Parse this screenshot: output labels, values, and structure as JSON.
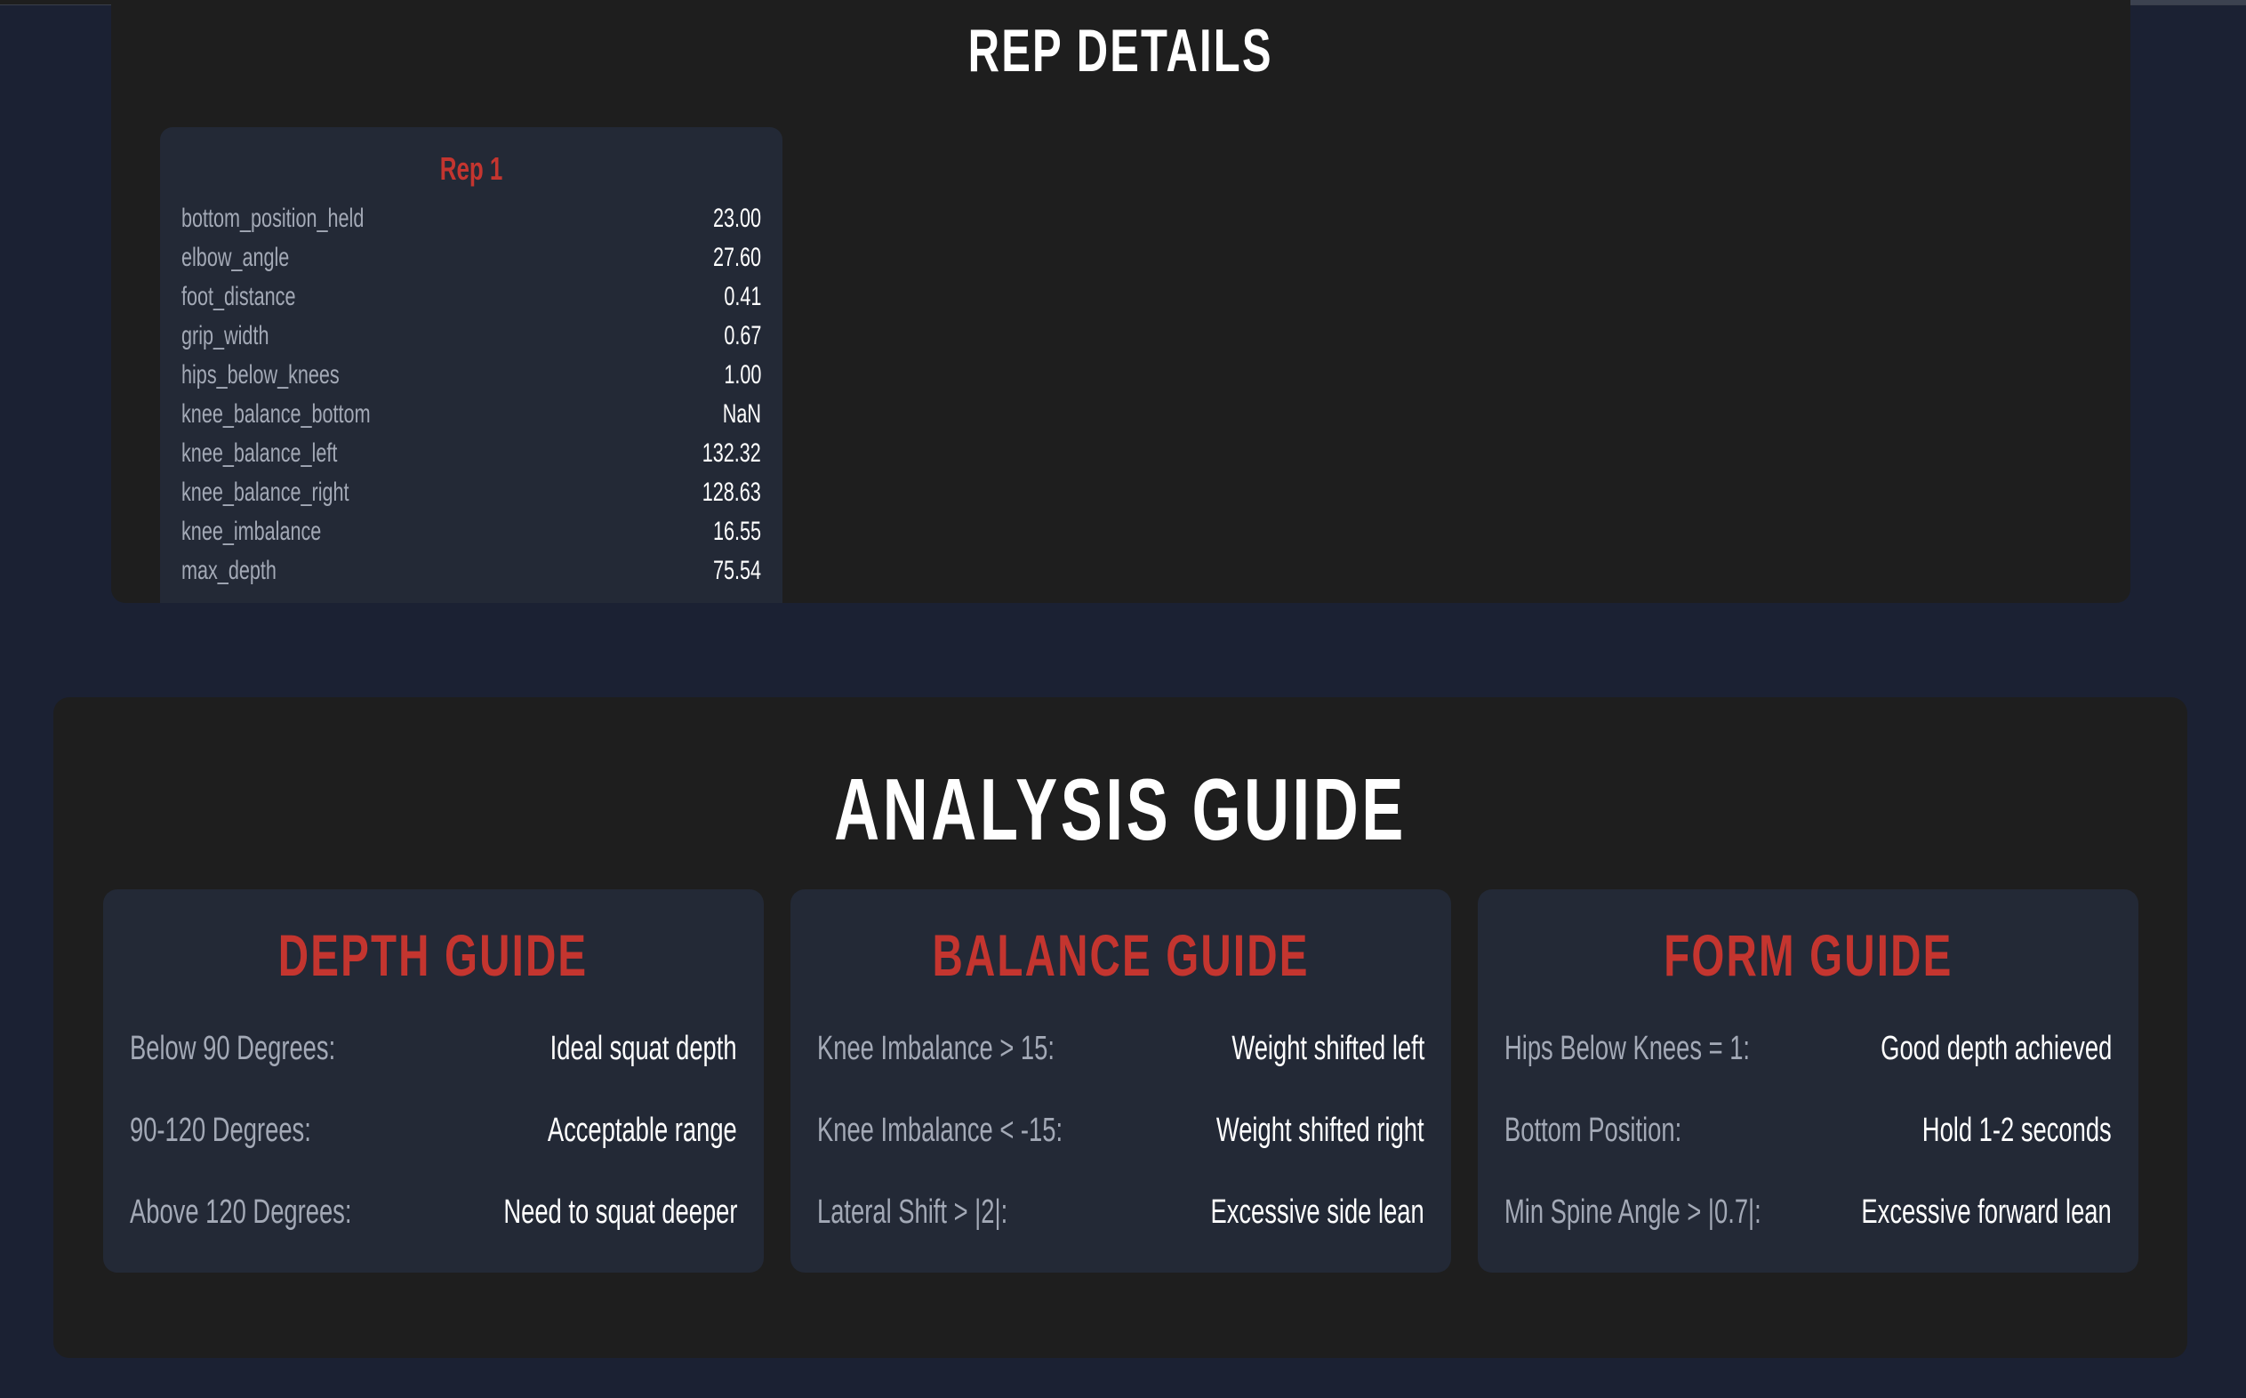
{
  "rep_details": {
    "title": "REP DETAILS",
    "reps": [
      {
        "label": "Rep 1",
        "metrics": [
          {
            "name": "bottom_position_held",
            "value": "23.00"
          },
          {
            "name": "elbow_angle",
            "value": "27.60"
          },
          {
            "name": "foot_distance",
            "value": "0.41"
          },
          {
            "name": "grip_width",
            "value": "0.67"
          },
          {
            "name": "hips_below_knees",
            "value": "1.00"
          },
          {
            "name": "knee_balance_bottom",
            "value": "NaN"
          },
          {
            "name": "knee_balance_left",
            "value": "132.32"
          },
          {
            "name": "knee_balance_right",
            "value": "128.63"
          },
          {
            "name": "knee_imbalance",
            "value": "16.55"
          },
          {
            "name": "max_depth",
            "value": "75.54"
          }
        ]
      }
    ]
  },
  "analysis_guide": {
    "title": "ANALYSIS GUIDE",
    "cards": [
      {
        "title": "DEPTH GUIDE",
        "rows": [
          {
            "label": "Below 90 Degrees:",
            "value": "Ideal squat depth"
          },
          {
            "label": "90-120 Degrees:",
            "value": "Acceptable range"
          },
          {
            "label": "Above 120 Degrees:",
            "value": "Need to squat deeper"
          }
        ]
      },
      {
        "title": "BALANCE GUIDE",
        "rows": [
          {
            "label": "Knee Imbalance > 15:",
            "value": "Weight shifted left"
          },
          {
            "label": "Knee Imbalance < -15:",
            "value": "Weight shifted right"
          },
          {
            "label": "Lateral Shift > |2|:",
            "value": "Excessive side lean"
          }
        ]
      },
      {
        "title": "FORM GUIDE",
        "rows": [
          {
            "label": "Hips Below Knees = 1:",
            "value": "Good depth achieved"
          },
          {
            "label": "Bottom Position:",
            "value": "Hold 1-2 seconds"
          },
          {
            "label": "Min Spine Angle > |0.7|:",
            "value": "Excessive forward lean"
          }
        ]
      }
    ]
  },
  "colors": {
    "page_bg": "#1b2133",
    "panel_bg": "#1e1e1e",
    "card_bg": "#232936",
    "accent_red": "#c4352f",
    "label_gray": "#a3a9b6",
    "value_white": "#ffffff"
  }
}
